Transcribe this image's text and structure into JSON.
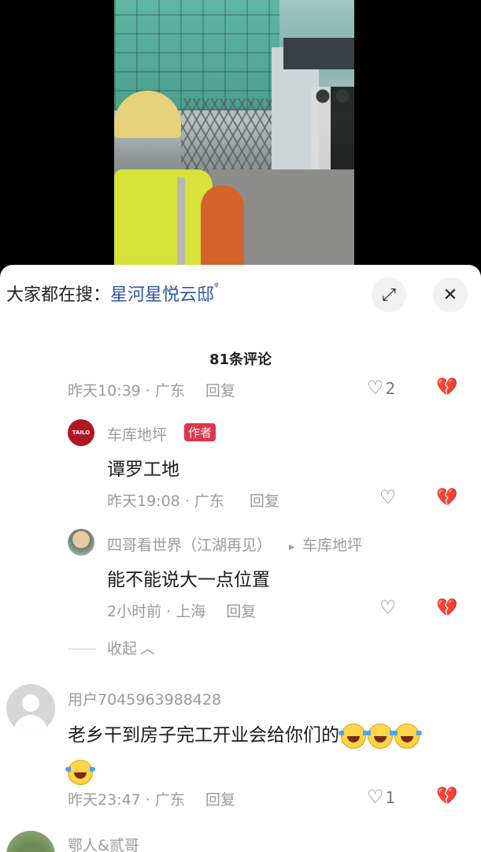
{
  "search": {
    "prefix": "大家都在搜：",
    "term": "星河星悦云邸",
    "icon": "search-icon"
  },
  "buttons": {
    "expand_icon": "⤢",
    "close_icon": "✕"
  },
  "comment_count": "81条评论",
  "top_meta": {
    "time": "昨天10:39 · 广东",
    "reply": "回复",
    "likes": "2"
  },
  "replies": [
    {
      "username": "车库地坪",
      "tag": "作者",
      "text": "谭罗工地",
      "time": "昨天19:08 · 广东",
      "reply": "回复",
      "avatar_label": "TAILO"
    },
    {
      "username": "四哥看世界（江湖再见）",
      "reply_to_arrow": "▸",
      "reply_to": "车库地坪",
      "text": "能不能说大一点位置",
      "time": "2小时前 · 上海",
      "reply": "回复"
    }
  ],
  "collapse_label": "收起",
  "comments": [
    {
      "username": "用户7045963988428",
      "text": "老乡干到房子完工开业会给你们的",
      "time": "昨天23:47 · 广东",
      "reply": "回复",
      "likes": "1"
    },
    {
      "username": "鄂人&贰哥"
    }
  ],
  "colors": {
    "tag": "#e0354b",
    "link": "#2b55a8"
  }
}
